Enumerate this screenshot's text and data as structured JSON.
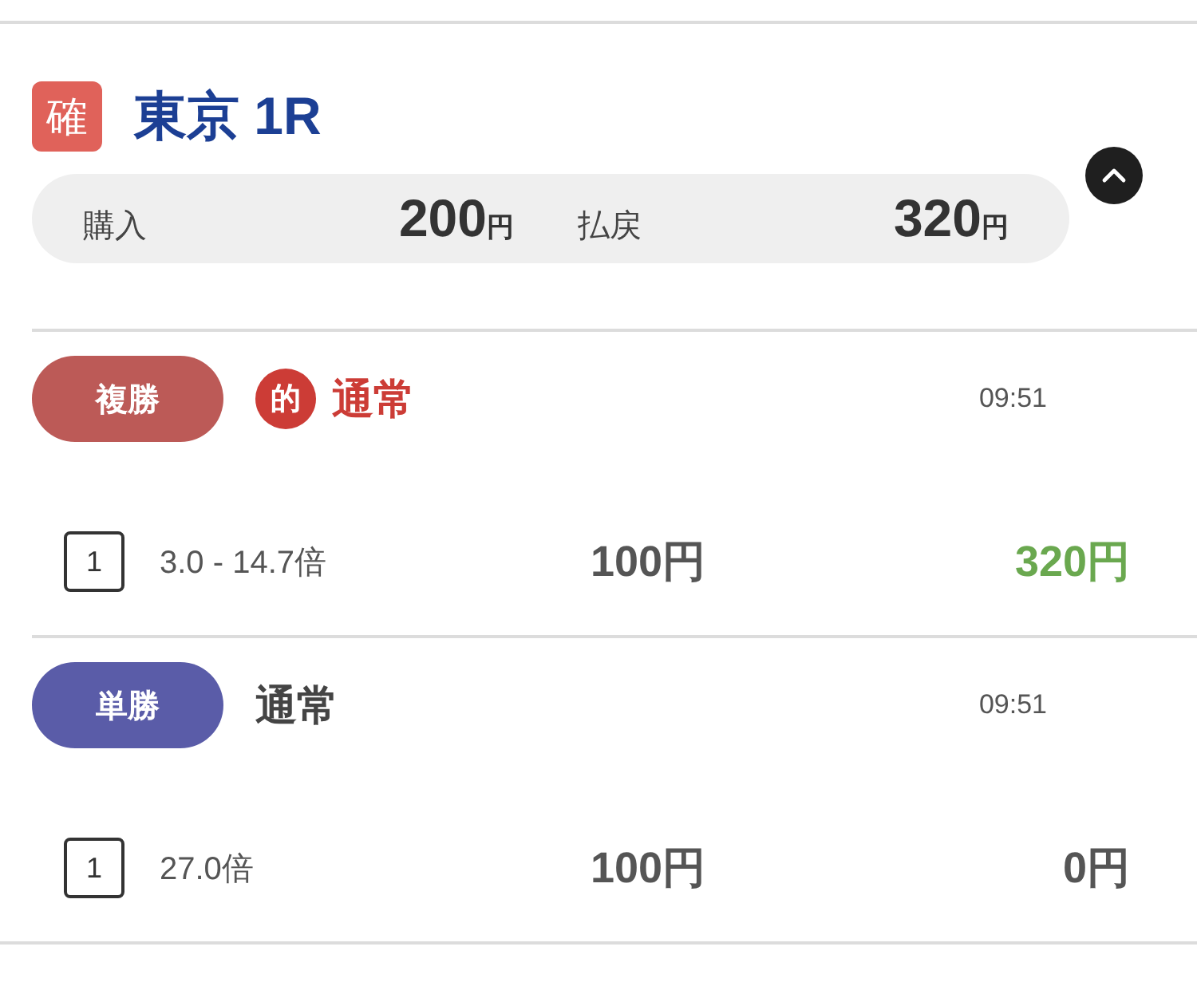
{
  "race": {
    "status_badge": "確",
    "title": "東京 1R",
    "expanded": true
  },
  "summary": {
    "purchase_label": "購入",
    "purchase_amount": "200",
    "purchase_unit": "円",
    "payout_label": "払戻",
    "payout_amount": "320",
    "payout_unit": "円"
  },
  "bets": [
    {
      "bet_type": "複勝",
      "color": "#bc5a57",
      "hit": true,
      "hit_badge": "的",
      "mode": "通常",
      "time": "09:51",
      "rows": [
        {
          "number": "1",
          "odds": "3.0 - 14.7倍",
          "stake": "100円",
          "payout": "320円"
        }
      ]
    },
    {
      "bet_type": "単勝",
      "color": "#5a5ca8",
      "hit": false,
      "mode": "通常",
      "time": "09:51",
      "rows": [
        {
          "number": "1",
          "odds": "27.0倍",
          "stake": "100円",
          "payout": "0円"
        }
      ]
    }
  ]
}
